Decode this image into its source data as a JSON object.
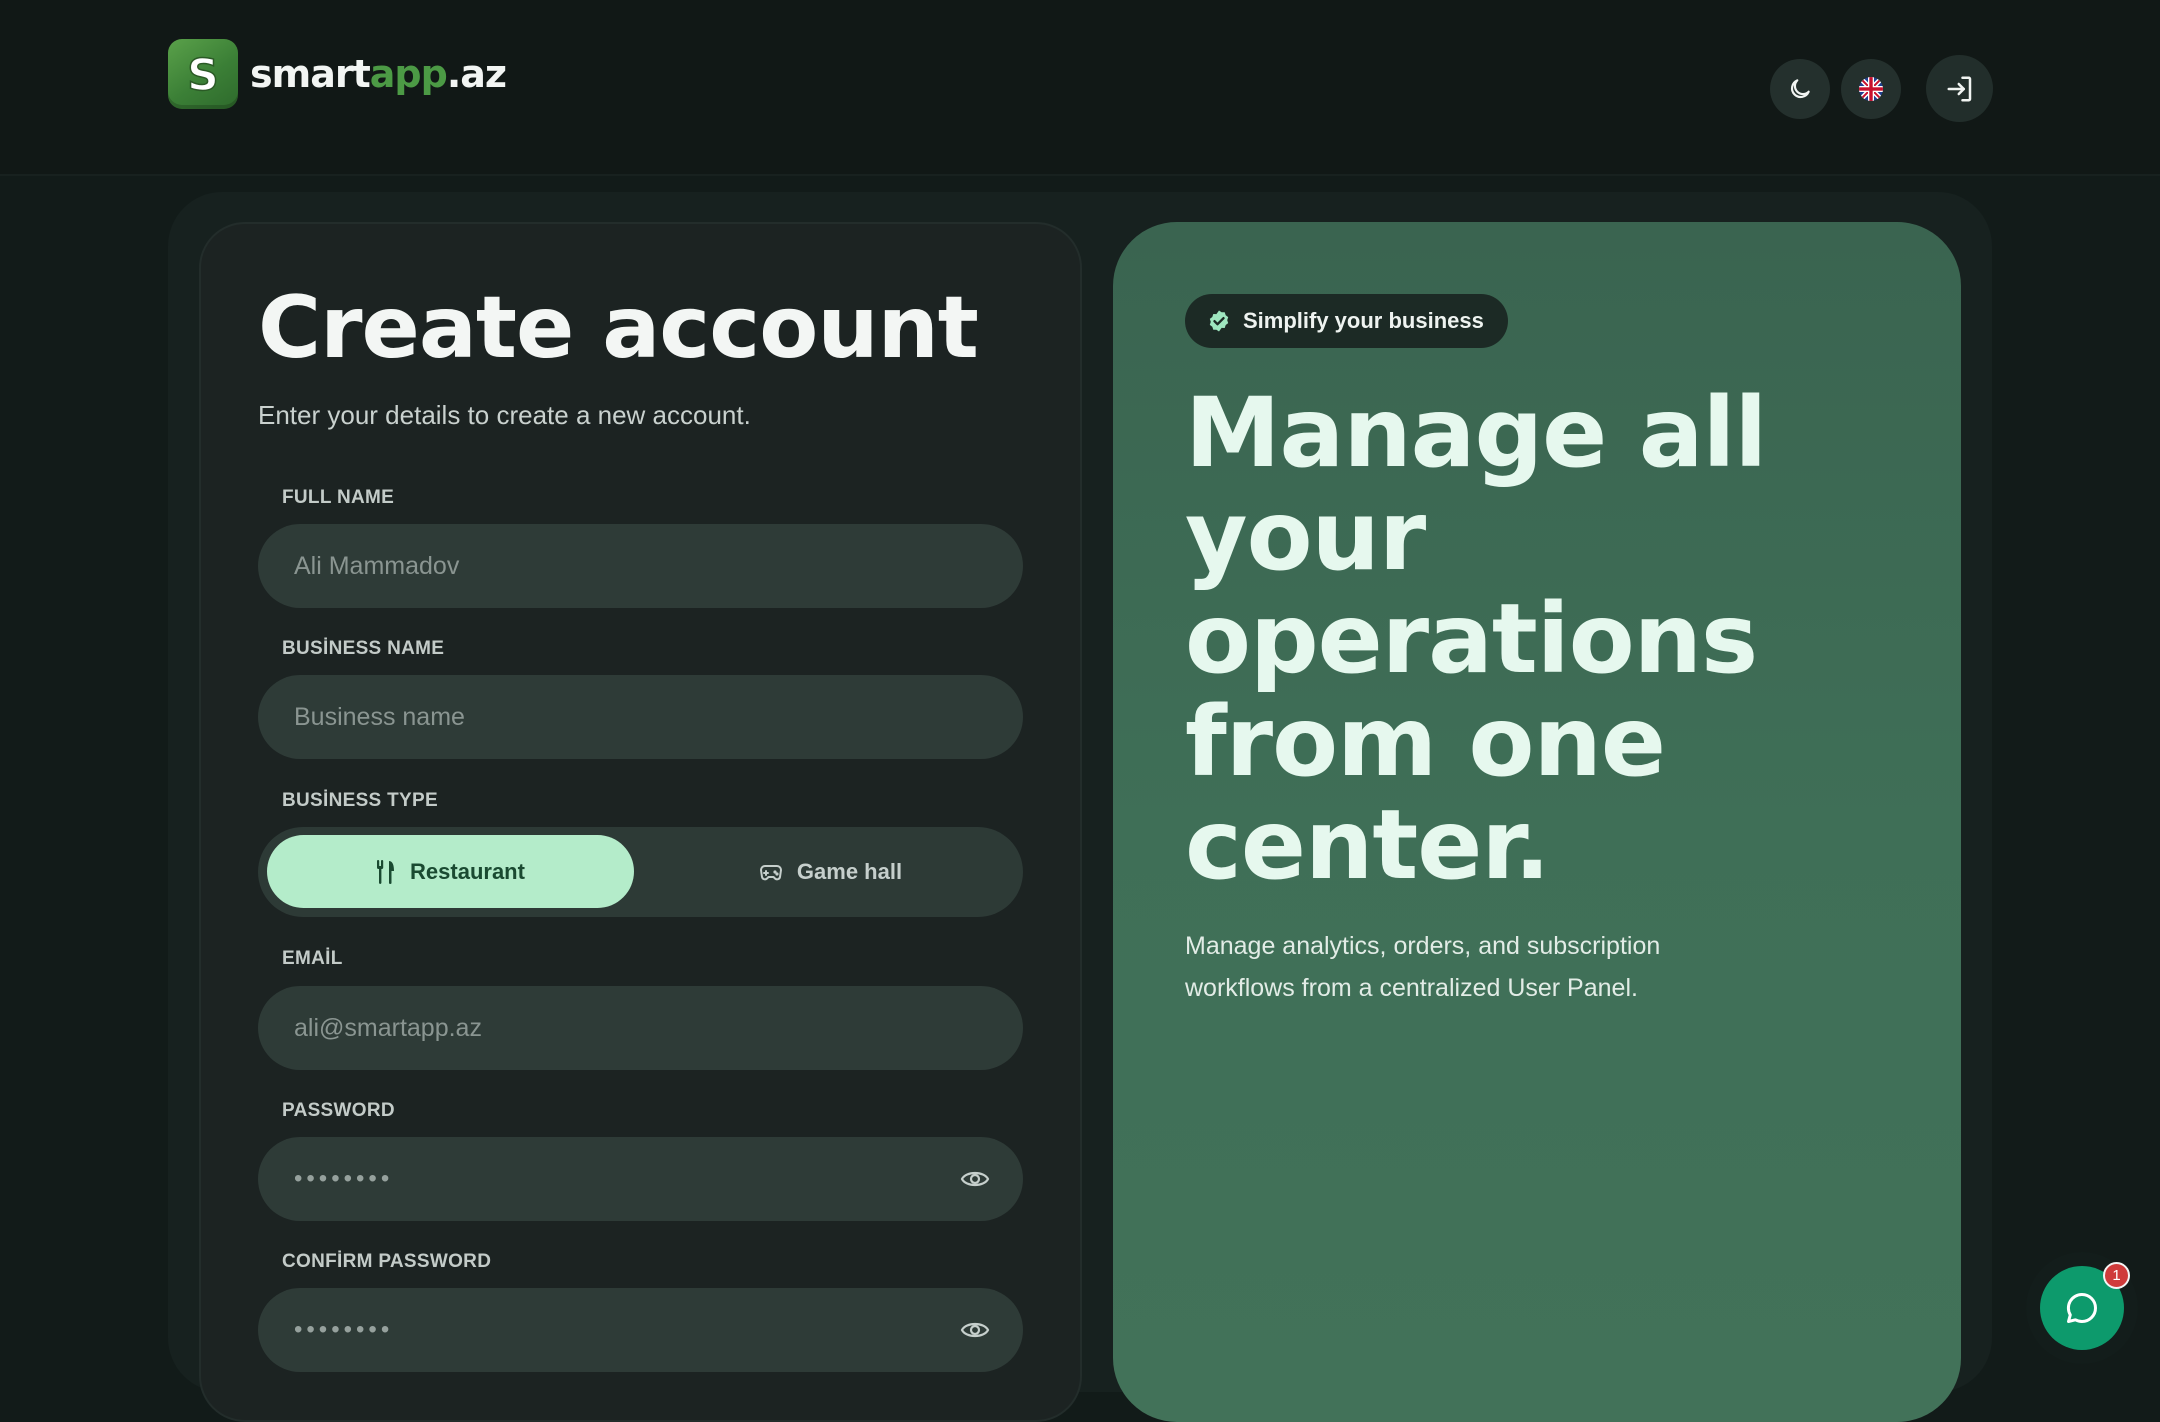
{
  "header": {
    "logo_letter": "S",
    "brand_part1": "smart",
    "brand_part2": "app",
    "brand_part3": ".az",
    "icons": [
      "moon-icon",
      "uk-flag-icon",
      "login-icon"
    ]
  },
  "form": {
    "title": "Create account",
    "subtitle": "Enter your details to create a new account.",
    "full_name": {
      "label": "FULL NAME",
      "placeholder": "Ali Mammadov"
    },
    "business_name": {
      "label": "BUSİNESS NAME",
      "placeholder": "Business name"
    },
    "business_type": {
      "label": "BUSİNESS TYPE",
      "options": [
        {
          "label": "Restaurant",
          "icon": "fork-knife-icon",
          "selected": true
        },
        {
          "label": "Game hall",
          "icon": "gamepad-icon",
          "selected": false
        }
      ]
    },
    "email": {
      "label": "EMAİL",
      "placeholder": "ali@smartapp.az"
    },
    "password": {
      "label": "PASSWORD",
      "value": "••••••••"
    },
    "confirm_password": {
      "label": "CONFİRM PASSWORD",
      "value": "••••••••"
    }
  },
  "promo": {
    "badge": "Simplify your business",
    "headline": "Manage all your operations from one center.",
    "description": "Manage analytics, orders, and subscription workflows from a centralized User Panel."
  },
  "chat": {
    "unread_count": "1"
  },
  "colors": {
    "background": "#121b19",
    "accent_green": "#4c9a45",
    "selected_option": "#b4ecca",
    "promo_green": "#3f6f57",
    "chat_button": "#0d9a6c"
  }
}
